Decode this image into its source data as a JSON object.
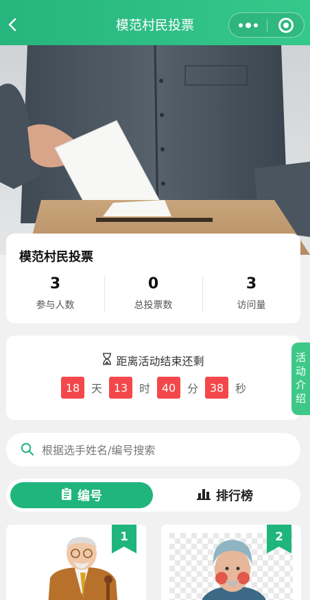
{
  "nav": {
    "title": "模范村民投票"
  },
  "activity": {
    "title": "模范村民投票",
    "stats": [
      {
        "value": "3",
        "label": "参与人数"
      },
      {
        "value": "0",
        "label": "总投票数"
      },
      {
        "value": "3",
        "label": "访问量"
      }
    ]
  },
  "countdown": {
    "heading": "距离活动结束还剩",
    "days": "18",
    "days_unit": "天",
    "hours": "13",
    "hours_unit": "时",
    "minutes": "40",
    "minutes_unit": "分",
    "seconds": "38",
    "seconds_unit": "秒"
  },
  "side_tab": {
    "chars": [
      "活",
      "动",
      "介",
      "绍"
    ]
  },
  "search": {
    "placeholder": "根据选手姓名/编号搜索"
  },
  "tabs": {
    "number_label": "编号",
    "ranking_label": "排行榜"
  },
  "candidates": [
    {
      "number": "1"
    },
    {
      "number": "2"
    }
  ],
  "colors": {
    "primary": "#1fb57c",
    "accent_red": "#f2484b",
    "nav_gradient_start": "#26b57c"
  }
}
